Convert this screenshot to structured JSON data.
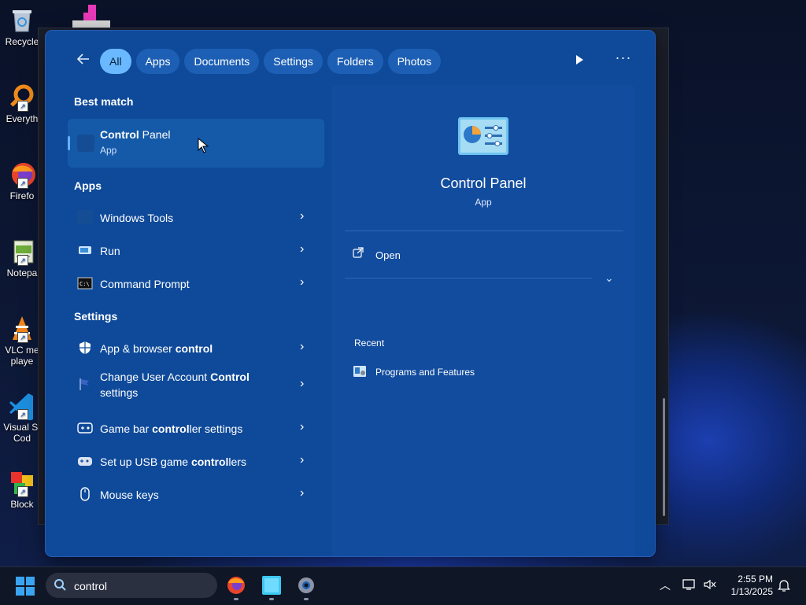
{
  "desktop": {
    "icons": [
      {
        "label": "Recycle",
        "icon": "recycle-bin-icon"
      },
      {
        "label": "Everyth",
        "icon": "everything-search-icon"
      },
      {
        "label": "Firefo",
        "icon": "firefox-icon"
      },
      {
        "label": "Notepa",
        "icon": "notepad-icon"
      },
      {
        "label": "VLC me",
        "label2": "playe",
        "icon": "vlc-icon"
      },
      {
        "label": "Visual St",
        "label2": "Cod",
        "icon": "vscode-icon"
      },
      {
        "label": "Block",
        "icon": "blocks-game-icon"
      }
    ]
  },
  "search_panel": {
    "filters": [
      "All",
      "Apps",
      "Documents",
      "Settings",
      "Folders",
      "Photos"
    ],
    "active_filter": "All",
    "best_match": {
      "heading": "Best match",
      "name_bold": "Control",
      "name_rest": " Panel",
      "type": "App"
    },
    "apps": {
      "heading": "Apps",
      "items": [
        "Windows Tools",
        "Run",
        "Command Prompt"
      ]
    },
    "settings": {
      "heading": "Settings",
      "items": [
        {
          "pre": "App & browser ",
          "bold": "control",
          "post": "",
          "line2": ""
        },
        {
          "pre": "Change User Account ",
          "bold": "Control",
          "post": "",
          "line2": "settings"
        },
        {
          "pre": "Game bar ",
          "bold": "control",
          "post": "ler settings",
          "line2": ""
        },
        {
          "pre": "Set up USB game ",
          "bold": "control",
          "post": "lers",
          "line2": ""
        },
        {
          "pre": "Mouse keys",
          "bold": "",
          "post": "",
          "line2": ""
        }
      ]
    },
    "preview": {
      "title": "Control Panel",
      "type": "App",
      "open_label": "Open",
      "recent_heading": "Recent",
      "recent_items": [
        "Programs and Features"
      ]
    }
  },
  "taskbar": {
    "search_value": "control",
    "time": "2:55 PM",
    "date": "1/13/2025"
  },
  "colors": {
    "panel_bg": "#0f4a9a",
    "active_pill": "#6ab8ff",
    "accent_bar": "#60b2ff"
  }
}
